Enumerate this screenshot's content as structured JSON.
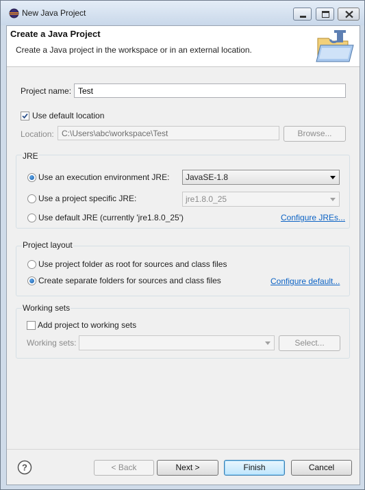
{
  "window": {
    "title": "New Java Project"
  },
  "header": {
    "title": "Create a Java Project",
    "description": "Create a Java project in the workspace or in an external location."
  },
  "project": {
    "name_label": "Project name:",
    "name_value": "Test",
    "use_default_location_label": "Use default location",
    "use_default_location_checked": true,
    "location_label": "Location:",
    "location_value": "C:\\Users\\abc\\workspace\\Test",
    "browse_label": "Browse..."
  },
  "jre": {
    "group_title": "JRE",
    "option_execution_env": "Use an execution environment JRE:",
    "execution_env_value": "JavaSE-1.8",
    "option_project_specific": "Use a project specific JRE:",
    "project_specific_value": "jre1.8.0_25",
    "option_default": "Use default JRE (currently 'jre1.8.0_25')",
    "configure_link": "Configure JREs..."
  },
  "layout": {
    "group_title": "Project layout",
    "option_root": "Use project folder as root for sources and class files",
    "option_separate": "Create separate folders for sources and class files",
    "configure_link": "Configure default..."
  },
  "working_sets": {
    "group_title": "Working sets",
    "add_label": "Add project to working sets",
    "sets_label": "Working sets:",
    "select_label": "Select..."
  },
  "footer": {
    "back_label": "< Back",
    "next_label": "Next >",
    "finish_label": "Finish",
    "cancel_label": "Cancel"
  },
  "icons": {
    "app": "eclipse-icon",
    "wizard": "java-project-folder-icon",
    "help": "help-icon"
  },
  "colors": {
    "link": "#0b62c4",
    "selected_radio": "#1c5fa8"
  }
}
